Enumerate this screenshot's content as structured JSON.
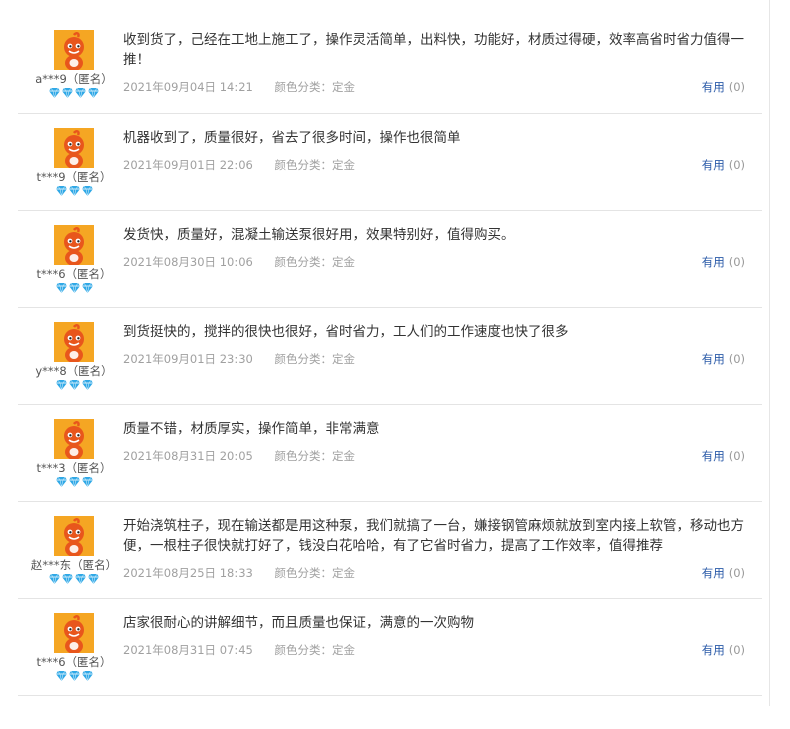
{
  "reviews": [
    {
      "user": "a***9（匿名）",
      "diamonds": 4,
      "text": "收到货了，己经在工地上施工了，操作灵活简单，出料快，功能好，材质过得硬，效率高省时省力值得一推！",
      "date": "2021年09月04日 14:21",
      "spec_label": "颜色分类：",
      "spec_value": "定金",
      "useful_label": "有用",
      "useful_count": "(0)"
    },
    {
      "user": "t***9（匿名）",
      "diamonds": 3,
      "text": "机器收到了，质量很好，省去了很多时间，操作也很简单",
      "date": "2021年09月01日 22:06",
      "spec_label": "颜色分类：",
      "spec_value": "定金",
      "useful_label": "有用",
      "useful_count": "(0)"
    },
    {
      "user": "t***6（匿名）",
      "diamonds": 3,
      "text": "发货快，质量好，混凝土输送泵很好用，效果特别好，值得购买。",
      "date": "2021年08月30日 10:06",
      "spec_label": "颜色分类：",
      "spec_value": "定金",
      "useful_label": "有用",
      "useful_count": "(0)"
    },
    {
      "user": "y***8（匿名）",
      "diamonds": 3,
      "text": "到货挺快的，搅拌的很快也很好，省时省力，工人们的工作速度也快了很多",
      "date": "2021年09月01日 23:30",
      "spec_label": "颜色分类：",
      "spec_value": "定金",
      "useful_label": "有用",
      "useful_count": "(0)"
    },
    {
      "user": "t***3（匿名）",
      "diamonds": 3,
      "text": "质量不错，材质厚实，操作简单，非常满意",
      "date": "2021年08月31日 20:05",
      "spec_label": "颜色分类：",
      "spec_value": "定金",
      "useful_label": "有用",
      "useful_count": "(0)"
    },
    {
      "user": "赵***东（匿名）",
      "diamonds": 4,
      "text": "开始浇筑柱子，现在输送都是用这种泵，我们就搞了一台，嫌接钢管麻烦就放到室内接上软管，移动也方便，一根柱子很快就打好了，钱没白花哈哈，有了它省时省力，提高了工作效率，值得推荐",
      "date": "2021年08月25日 18:33",
      "spec_label": "颜色分类：",
      "spec_value": "定金",
      "useful_label": "有用",
      "useful_count": "(0)"
    },
    {
      "user": "t***6（匿名）",
      "diamonds": 3,
      "text": "店家很耐心的讲解细节，而且质量也保证，满意的一次购物",
      "date": "2021年08月31日 07:45",
      "spec_label": "颜色分类：",
      "spec_value": "定金",
      "useful_label": "有用",
      "useful_count": "(0)"
    }
  ],
  "colors": {
    "avatar_bg": "#f5a623",
    "mascot": "#e8561c",
    "diamond": "#2fa8e6",
    "useful_link": "#2a5aa8"
  },
  "icons": {
    "avatar": "orange-mascot-avatar",
    "level": "blue-diamond-icon"
  }
}
